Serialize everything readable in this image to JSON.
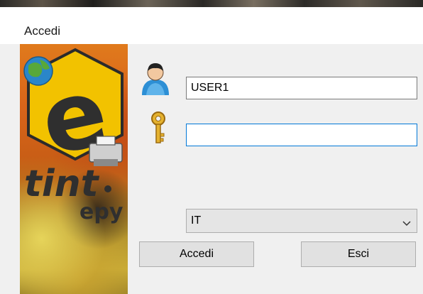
{
  "window": {
    "title": "Accedi"
  },
  "logo": {
    "brand_letter": "e",
    "brand_name": "tint",
    "brand_suffix": "epy"
  },
  "form": {
    "username": {
      "value": "USER1",
      "placeholder": ""
    },
    "password": {
      "value": "",
      "placeholder": ""
    },
    "language": {
      "selected": "IT"
    }
  },
  "buttons": {
    "login_label": "Accedi",
    "exit_label": "Esci"
  },
  "icons": {
    "user": "user-icon",
    "key": "key-icon",
    "globe": "globe-icon",
    "printer": "printer-icon",
    "dropdown": "chevron-down-icon"
  },
  "colors": {
    "focus_border": "#0078d7",
    "logo_hex": "#f2c200",
    "logo_orange": "#e07a1c"
  }
}
